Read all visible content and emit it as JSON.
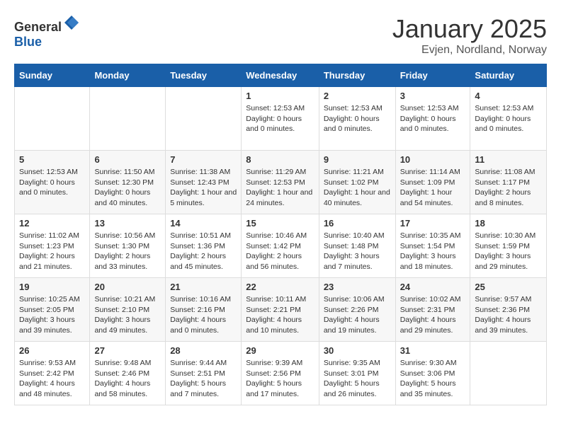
{
  "header": {
    "logo_general": "General",
    "logo_blue": "Blue",
    "month": "January 2025",
    "location": "Evjen, Nordland, Norway"
  },
  "days_of_week": [
    "Sunday",
    "Monday",
    "Tuesday",
    "Wednesday",
    "Thursday",
    "Friday",
    "Saturday"
  ],
  "weeks": [
    [
      {
        "day": "",
        "content": ""
      },
      {
        "day": "",
        "content": ""
      },
      {
        "day": "",
        "content": ""
      },
      {
        "day": "1",
        "content": "Sunset: 12:53 AM\nDaylight: 0 hours and 0 minutes."
      },
      {
        "day": "2",
        "content": "Sunset: 12:53 AM\nDaylight: 0 hours and 0 minutes."
      },
      {
        "day": "3",
        "content": "Sunset: 12:53 AM\nDaylight: 0 hours and 0 minutes."
      },
      {
        "day": "4",
        "content": "Sunset: 12:53 AM\nDaylight: 0 hours and 0 minutes."
      }
    ],
    [
      {
        "day": "5",
        "content": "Sunset: 12:53 AM\nDaylight: 0 hours and 0 minutes."
      },
      {
        "day": "6",
        "content": "Sunrise: 11:50 AM\nSunset: 12:30 PM\nDaylight: 0 hours and 40 minutes."
      },
      {
        "day": "7",
        "content": "Sunrise: 11:38 AM\nSunset: 12:43 PM\nDaylight: 1 hour and 5 minutes."
      },
      {
        "day": "8",
        "content": "Sunrise: 11:29 AM\nSunset: 12:53 PM\nDaylight: 1 hour and 24 minutes."
      },
      {
        "day": "9",
        "content": "Sunrise: 11:21 AM\nSunset: 1:02 PM\nDaylight: 1 hour and 40 minutes."
      },
      {
        "day": "10",
        "content": "Sunrise: 11:14 AM\nSunset: 1:09 PM\nDaylight: 1 hour and 54 minutes."
      },
      {
        "day": "11",
        "content": "Sunrise: 11:08 AM\nSunset: 1:17 PM\nDaylight: 2 hours and 8 minutes."
      }
    ],
    [
      {
        "day": "12",
        "content": "Sunrise: 11:02 AM\nSunset: 1:23 PM\nDaylight: 2 hours and 21 minutes."
      },
      {
        "day": "13",
        "content": "Sunrise: 10:56 AM\nSunset: 1:30 PM\nDaylight: 2 hours and 33 minutes."
      },
      {
        "day": "14",
        "content": "Sunrise: 10:51 AM\nSunset: 1:36 PM\nDaylight: 2 hours and 45 minutes."
      },
      {
        "day": "15",
        "content": "Sunrise: 10:46 AM\nSunset: 1:42 PM\nDaylight: 2 hours and 56 minutes."
      },
      {
        "day": "16",
        "content": "Sunrise: 10:40 AM\nSunset: 1:48 PM\nDaylight: 3 hours and 7 minutes."
      },
      {
        "day": "17",
        "content": "Sunrise: 10:35 AM\nSunset: 1:54 PM\nDaylight: 3 hours and 18 minutes."
      },
      {
        "day": "18",
        "content": "Sunrise: 10:30 AM\nSunset: 1:59 PM\nDaylight: 3 hours and 29 minutes."
      }
    ],
    [
      {
        "day": "19",
        "content": "Sunrise: 10:25 AM\nSunset: 2:05 PM\nDaylight: 3 hours and 39 minutes."
      },
      {
        "day": "20",
        "content": "Sunrise: 10:21 AM\nSunset: 2:10 PM\nDaylight: 3 hours and 49 minutes."
      },
      {
        "day": "21",
        "content": "Sunrise: 10:16 AM\nSunset: 2:16 PM\nDaylight: 4 hours and 0 minutes."
      },
      {
        "day": "22",
        "content": "Sunrise: 10:11 AM\nSunset: 2:21 PM\nDaylight: 4 hours and 10 minutes."
      },
      {
        "day": "23",
        "content": "Sunrise: 10:06 AM\nSunset: 2:26 PM\nDaylight: 4 hours and 19 minutes."
      },
      {
        "day": "24",
        "content": "Sunrise: 10:02 AM\nSunset: 2:31 PM\nDaylight: 4 hours and 29 minutes."
      },
      {
        "day": "25",
        "content": "Sunrise: 9:57 AM\nSunset: 2:36 PM\nDaylight: 4 hours and 39 minutes."
      }
    ],
    [
      {
        "day": "26",
        "content": "Sunrise: 9:53 AM\nSunset: 2:42 PM\nDaylight: 4 hours and 48 minutes."
      },
      {
        "day": "27",
        "content": "Sunrise: 9:48 AM\nSunset: 2:46 PM\nDaylight: 4 hours and 58 minutes."
      },
      {
        "day": "28",
        "content": "Sunrise: 9:44 AM\nSunset: 2:51 PM\nDaylight: 5 hours and 7 minutes."
      },
      {
        "day": "29",
        "content": "Sunrise: 9:39 AM\nSunset: 2:56 PM\nDaylight: 5 hours and 17 minutes."
      },
      {
        "day": "30",
        "content": "Sunrise: 9:35 AM\nSunset: 3:01 PM\nDaylight: 5 hours and 26 minutes."
      },
      {
        "day": "31",
        "content": "Sunrise: 9:30 AM\nSunset: 3:06 PM\nDaylight: 5 hours and 35 minutes."
      },
      {
        "day": "",
        "content": ""
      }
    ]
  ]
}
